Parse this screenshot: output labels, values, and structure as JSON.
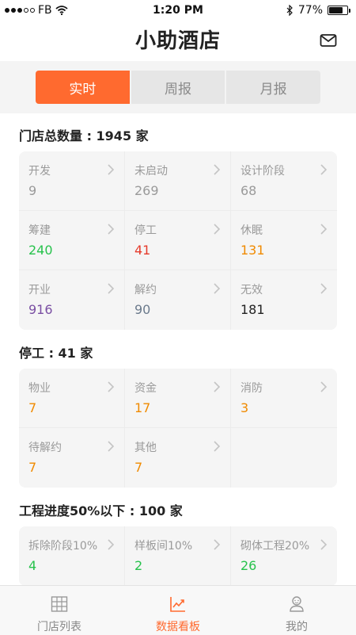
{
  "status_bar": {
    "carrier": "FB",
    "time": "1:20 PM",
    "battery": "77%",
    "battery_level": 0.77,
    "signal_bars": 3
  },
  "header": {
    "title": "小助酒店",
    "mail_icon": "mail-icon"
  },
  "tabs": [
    {
      "label": "实时",
      "active": true
    },
    {
      "label": "周报",
      "active": false
    },
    {
      "label": "月报",
      "active": false
    }
  ],
  "sections": {
    "total": {
      "title": "门店总数量 : 1945 家",
      "items": [
        {
          "label": "开发",
          "value": "9",
          "color": "#9a9a9a"
        },
        {
          "label": "未启动",
          "value": "269",
          "color": "#9a9a9a"
        },
        {
          "label": "设计阶段",
          "value": "68",
          "color": "#9a9a9a"
        },
        {
          "label": "筹建",
          "value": "240",
          "color": "#27c24c"
        },
        {
          "label": "停工",
          "value": "41",
          "color": "#e53b2c"
        },
        {
          "label": "休眠",
          "value": "131",
          "color": "#f08a00"
        },
        {
          "label": "开业",
          "value": "916",
          "color": "#7a4fa3"
        },
        {
          "label": "解约",
          "value": "90",
          "color": "#6b7a8c"
        },
        {
          "label": "无效",
          "value": "181",
          "color": "#222222"
        }
      ]
    },
    "stopped": {
      "title": "停工 : 41 家",
      "items": [
        {
          "label": "物业",
          "value": "7",
          "color": "#f08a00"
        },
        {
          "label": "资金",
          "value": "17",
          "color": "#f08a00"
        },
        {
          "label": "消防",
          "value": "3",
          "color": "#f08a00"
        },
        {
          "label": "待解约",
          "value": "7",
          "color": "#f08a00"
        },
        {
          "label": "其他",
          "value": "7",
          "color": "#f08a00"
        }
      ]
    },
    "progress": {
      "title": "工程进度50%以下 : 100 家",
      "items": [
        {
          "label": "拆除阶段10%",
          "value": "4",
          "color": "#27c24c"
        },
        {
          "label": "样板间10%",
          "value": "2",
          "color": "#27c24c"
        },
        {
          "label": "砌体工程20%",
          "value": "26",
          "color": "#27c24c"
        }
      ]
    }
  },
  "tabbar": [
    {
      "label": "门店列表",
      "icon": "building-icon",
      "active": false
    },
    {
      "label": "数据看板",
      "icon": "chart-icon",
      "active": true
    },
    {
      "label": "我的",
      "icon": "profile-icon",
      "active": false
    }
  ],
  "colors": {
    "accent": "#ff6a2f"
  }
}
